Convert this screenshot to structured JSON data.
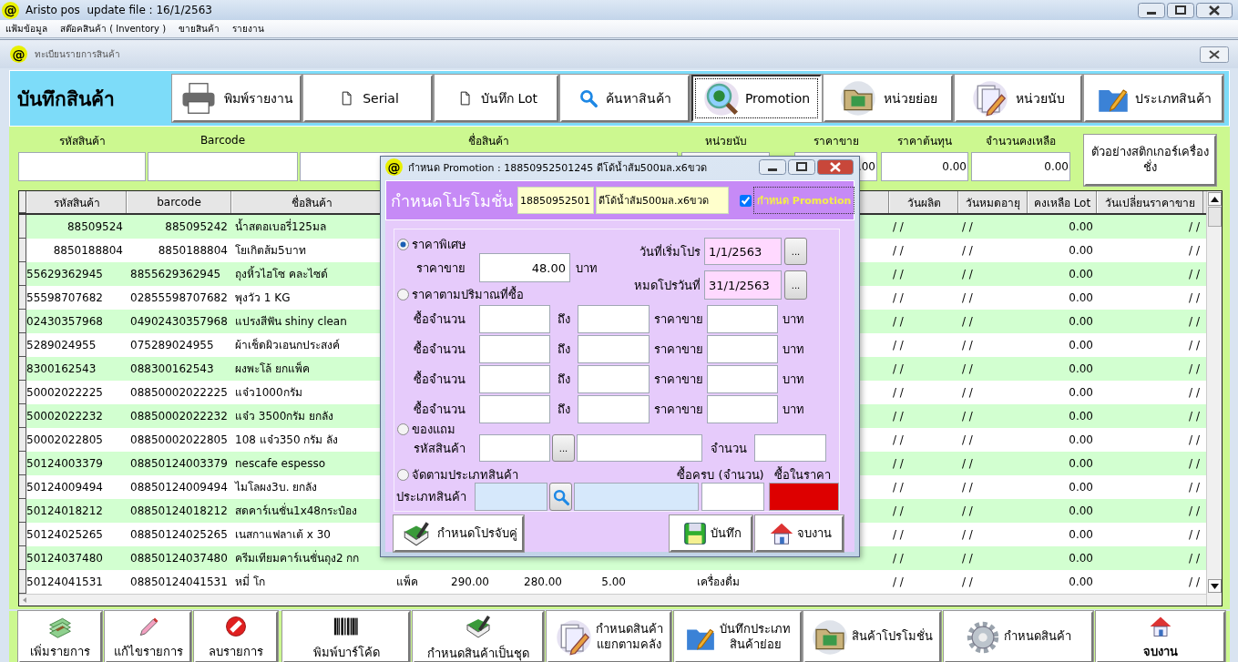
{
  "window": {
    "logo": "@",
    "title": "Aristo pos  update file : 16/1/2563"
  },
  "menu": [
    "แฟ้มข้อมูล",
    "สต๊อคสินค้า ( Inventory )",
    "ขายสินค้า",
    "รายงาน"
  ],
  "child_window": {
    "logo": "@",
    "title": "ทะเบียนรายการสินค้า"
  },
  "header": {
    "title": "บันทึกสินค้า",
    "toolbar": [
      {
        "label": "พิมพ์รายงาน",
        "focused": false
      },
      {
        "label": "Serial",
        "focused": false
      },
      {
        "label": "บันทึก Lot",
        "focused": false
      },
      {
        "label": "ค้นหาสินค้า",
        "focused": false
      },
      {
        "label": "Promotion",
        "focused": true
      },
      {
        "label": "หน่วยย่อย",
        "focused": false
      },
      {
        "label": "หน่วยนับ",
        "focused": false
      },
      {
        "label": "ประเภทสินค้า",
        "focused": false
      }
    ]
  },
  "form": {
    "fields": [
      {
        "label": "รหัสสินค้า"
      },
      {
        "label": "Barcode"
      },
      {
        "label": "ชื่อสินค้า"
      },
      {
        "label": "หน่วยนับ"
      },
      {
        "label": "ราคาขาย",
        "value": ".00"
      },
      {
        "label": "ราคาต้นทุน",
        "value": "0.00"
      },
      {
        "label": "จำนวนคงเหลือ",
        "value": "0.00"
      }
    ],
    "sticker_button": "ตัวอย่างสติกเกอร์เครื่องชั่ง"
  },
  "table": {
    "columns": [
      "รหัสสินค้า",
      "barcode",
      "ชื่อสินค้า",
      "วันผลิต",
      "วันหมดอายุ",
      "คงเหลือ Lot",
      "วันเปลี่ยนราคาขาย"
    ],
    "rows": [
      {
        "kind": "numeric",
        "code": "88509524",
        "barcode": "885095242",
        "name": "น้ำสตอเบอรี่125มล",
        "mfg": "/ /",
        "exp": "/ /",
        "lot": "0.00",
        "changed": "/ /"
      },
      {
        "kind": "numeric",
        "code": "8850188804",
        "barcode": "8850188804",
        "name": "โยเกิตส้ม5บาท",
        "mfg": "/ /",
        "exp": "/ /",
        "lot": "0.00",
        "changed": "/ /"
      },
      {
        "kind": "text",
        "code": "55629362945",
        "barcode": "8855629362945",
        "name": "ถุงหิ้วไฮโซ  คละไซด์",
        "mfg": "/ /",
        "exp": "/ /",
        "lot": "0.00",
        "changed": "/ /"
      },
      {
        "kind": "text",
        "code": "55598707682",
        "barcode": "02855598707682",
        "name": "พุงวัว 1 KG",
        "mfg": "/ /",
        "exp": "/ /",
        "lot": "0.00",
        "changed": "/ /"
      },
      {
        "kind": "text",
        "code": "02430357968",
        "barcode": "04902430357968",
        "name": "แปรงสีฟัน shiny clean",
        "mfg": "/ /",
        "exp": "/ /",
        "lot": "0.00",
        "changed": "/ /"
      },
      {
        "kind": "text",
        "code": "5289024955",
        "barcode": "075289024955",
        "name": "ผ้าเช็ดผิวเอนกประสงค์",
        "mfg": "/ /",
        "exp": "/ /",
        "lot": "0.00",
        "changed": "/ /"
      },
      {
        "kind": "text",
        "code": "8300162543",
        "barcode": "088300162543",
        "name": "ผงพะโล้ ยกแพ็ค",
        "mfg": "/ /",
        "exp": "/ /",
        "lot": "0.00",
        "changed": "/ /"
      },
      {
        "kind": "text",
        "code": "50002022225",
        "barcode": "08850002022225",
        "name": "แจ๋ว1000กรัม",
        "mfg": "/ /",
        "exp": "/ /",
        "lot": "0.00",
        "changed": "/ /"
      },
      {
        "kind": "text",
        "code": "50002022232",
        "barcode": "08850002022232",
        "name": "แจ๋ว 3500กรัม ยกลัง",
        "mfg": "/ /",
        "exp": "/ /",
        "lot": "0.00",
        "changed": "/ /"
      },
      {
        "kind": "text",
        "code": "50002022805",
        "barcode": "08850002022805",
        "name": "108 แจ๋ว350 กรัม ลัง",
        "mfg": "/ /",
        "exp": "/ /",
        "lot": "0.00",
        "changed": "/ /"
      },
      {
        "kind": "text",
        "code": "50124003379",
        "barcode": "08850124003379",
        "name": "nescafe espesso",
        "mfg": "/ /",
        "exp": "/ /",
        "lot": "0.00",
        "changed": "/ /"
      },
      {
        "kind": "text",
        "code": "50124009494",
        "barcode": "08850124009494",
        "name": "ไมโลผง3บ. ยกลัง",
        "mfg": "/ /",
        "exp": "/ /",
        "lot": "0.00",
        "changed": "/ /"
      },
      {
        "kind": "text",
        "code": "50124018212",
        "barcode": "08850124018212",
        "name": "สดคาร์เนชั่น1x48กระป๋อง",
        "mfg": "/ /",
        "exp": "/ /",
        "lot": "0.00",
        "changed": "/ /"
      },
      {
        "kind": "text",
        "code": "50124025265",
        "barcode": "08850124025265",
        "name": "เนสกาแฟลาเต้ x 30",
        "mfg": "/ /",
        "exp": "/ /",
        "lot": "0.00",
        "changed": "/ /"
      },
      {
        "kind": "text",
        "code": "50124037480",
        "barcode": "08850124037480",
        "name": "ครีมเทียมคาร์เนชั่นถุง2 กก",
        "mfg": "/ /",
        "exp": "/ /",
        "lot": "0.00",
        "changed": "/ /"
      },
      {
        "kind": "text",
        "code": "50124041531",
        "barcode": "08850124041531",
        "name": "หมี่ โก",
        "unit": "แพ็ค",
        "price": "290.00",
        "cost": "280.00",
        "stock": "5.00",
        "category": "เครื่องดื่ม",
        "mfg": "/ /",
        "exp": "/ /",
        "lot": "0.00",
        "changed": "/ /"
      }
    ]
  },
  "dialog": {
    "logo": "@",
    "title": "กำหนด Promotion : 18850952501245 ดีโด้น้ำส้ม500มล.x6ขวด",
    "heading": "กำหนดโปรโมชั่น",
    "product_code": "18850952501",
    "product_name": "ดีโด้น้ำส้ม500มล.x6ขวด",
    "enable": {
      "label": "กำหนด Promotion",
      "checked": true
    },
    "options": [
      {
        "label": "ราคาพิเศษ",
        "selected": true
      },
      {
        "label": "ราคาตามปริมาณที่ซื้อ",
        "selected": false
      },
      {
        "label": "ของแถม",
        "selected": false
      },
      {
        "label": "จัดตามประเภทสินค้า",
        "selected": false
      }
    ],
    "special": {
      "price_label": "ราคาขาย",
      "price": "48.00",
      "unit": "บาท",
      "start_label": "วันที่เริ่มโปร",
      "start": "1/1/2563",
      "start_button": "...",
      "end_label": "หมดโปรวันที่",
      "end": "31/1/2563",
      "end_button": "..."
    },
    "tiers": [
      {
        "qty_label": "ซื้อจำนวน",
        "to_label": "ถึง",
        "price_label": "ราคาขาย",
        "unit": "บาท"
      },
      {
        "qty_label": "ซื้อจำนวน",
        "to_label": "ถึง",
        "price_label": "ราคาขาย",
        "unit": "บาท"
      },
      {
        "qty_label": "ซื้อจำนวน",
        "to_label": "ถึง",
        "price_label": "ราคาขาย",
        "unit": "บาท"
      },
      {
        "qty_label": "ซื้อจำนวน",
        "to_label": "ถึง",
        "price_label": "ราคาขาย",
        "unit": "บาท"
      }
    ],
    "gift": {
      "code_label": "รหัสสินค้า",
      "browse": "...",
      "qty_label": "จำนวน"
    },
    "category": {
      "qty_label": "ซื้อครบ (จำนวน)",
      "price_label": "ซื้อในราคา",
      "type_label": "ประเภทสินค้า"
    },
    "buttons": [
      "กำหนดโปรจับคู่",
      "บันทึก",
      "จบงาน"
    ]
  },
  "bottom_toolbar": [
    "เพิ่มรายการ",
    "แก้ไขรายการ",
    "ลบรายการ",
    "พิมพ์บาร์โค้ด",
    "กำหนดสินค้าเป็นชุด",
    "กำหนดสินค้า\nแยกตามคลัง",
    "บันทึกประเภท\nสินค้าย่อย",
    "สินค้าโปรโมชั่น",
    "กำหนดสินค้า",
    "จบงาน"
  ]
}
